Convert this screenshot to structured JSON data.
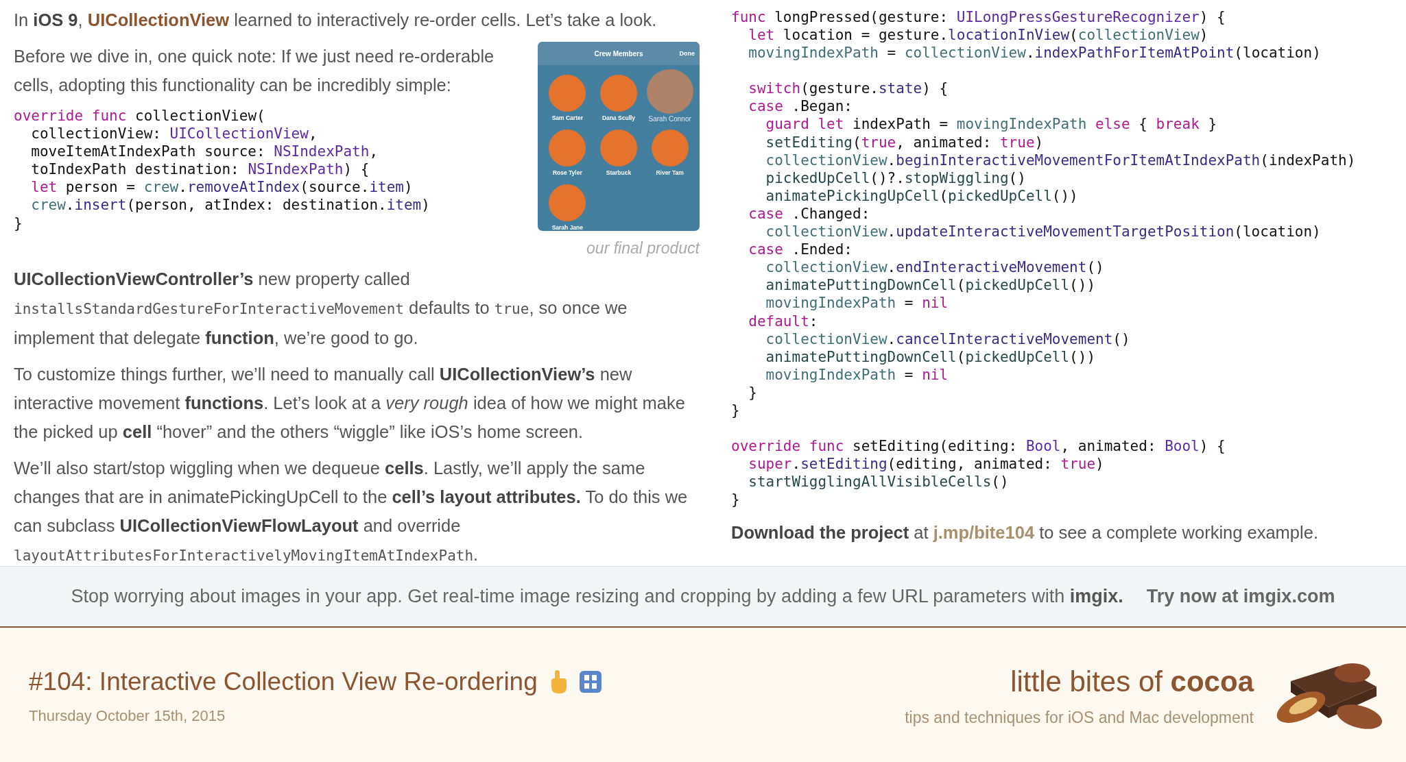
{
  "article": {
    "intro": [
      {
        "kind": "text",
        "text": "In **iOS 9**, "
      },
      {
        "kind": "link",
        "text": "UICollectionView"
      },
      {
        "kind": "text",
        "text": " learned to interactively re-order cells. Let’s take a look."
      }
    ],
    "note": [
      {
        "kind": "text",
        "text": "Before we dive in, one quick note: If we just need re-orderable cells, adopting this functionality can be incredibly simple:"
      }
    ],
    "figure": {
      "title": "Crew Members",
      "done": "Done",
      "caption": "our final product",
      "crew": [
        {
          "name": "Sam Carter",
          "lifted": false
        },
        {
          "name": "Dana Scully",
          "lifted": false
        },
        {
          "name": "Sarah Connor",
          "lifted": true
        },
        {
          "name": "Rose Tyler",
          "lifted": false
        },
        {
          "name": "Starbuck",
          "lifted": false
        },
        {
          "name": "River Tam",
          "lifted": false
        },
        {
          "name": "Sarah Jane",
          "lifted": false
        }
      ]
    },
    "code_left": [
      [
        [
          {
            "kind": "kw",
            "text": "override func"
          },
          {
            "kind": "p",
            "text": " collectionView("
          }
        ],
        [
          {
            "kind": "p",
            "text": "  collectionView: "
          },
          {
            "kind": "type",
            "text": "UICollectionView"
          },
          {
            "kind": "p",
            "text": ","
          }
        ],
        [
          {
            "kind": "p",
            "text": "  moveItemAtIndexPath source: "
          },
          {
            "kind": "type",
            "text": "NSIndexPath"
          },
          {
            "kind": "p",
            "text": ","
          }
        ],
        [
          {
            "kind": "p",
            "text": "  toIndexPath destination: "
          },
          {
            "kind": "type",
            "text": "NSIndexPath"
          },
          {
            "kind": "p",
            "text": ") {"
          }
        ],
        [
          {
            "kind": "kw",
            "text": "  let"
          },
          {
            "kind": "p",
            "text": " person = "
          },
          {
            "kind": "prop",
            "text": "crew"
          },
          {
            "kind": "p",
            "text": "."
          },
          {
            "kind": "sys",
            "text": "removeAtIndex"
          },
          {
            "kind": "p",
            "text": "(source."
          },
          {
            "kind": "sys",
            "text": "item"
          },
          {
            "kind": "p",
            "text": ")"
          }
        ],
        [
          {
            "kind": "prop",
            "text": "  crew"
          },
          {
            "kind": "p",
            "text": "."
          },
          {
            "kind": "sys",
            "text": "insert"
          },
          {
            "kind": "p",
            "text": "(person, atIndex: destination."
          },
          {
            "kind": "sys",
            "text": "item"
          },
          {
            "kind": "p",
            "text": ")"
          }
        ],
        [
          {
            "kind": "p",
            "text": "}"
          }
        ]
      ]
    ],
    "paragraphs": [
      [
        {
          "kind": "text",
          "text": "**UICollectionViewController’s** new property called "
        },
        {
          "kind": "code",
          "text": "installsStandardGestureForInteractiveMovement"
        },
        {
          "kind": "text",
          "text": " defaults to "
        },
        {
          "kind": "code",
          "text": "true"
        },
        {
          "kind": "text",
          "text": ", so once we implement that delegate **function**, we’re good to go."
        }
      ],
      [
        {
          "kind": "text",
          "text": "To customize things further, we’ll need to manually call **UICollectionView’s** new interactive movement **functions**. Let’s look at a *very rough* idea of how we might make the picked up **cell** “hover” and the others “wiggle” like iOS’s home screen."
        }
      ],
      [
        {
          "kind": "text",
          "text": "We’ll also start/stop wiggling when we dequeue **cells**. Lastly, we’ll apply the same changes that are in animatePickingUpCell to the **cell’s layout attributes.** To do this we can subclass **UICollectionViewFlowLayout** and override "
        },
        {
          "kind": "code",
          "text": "layoutAttributesForInteractivelyMovingItemAtIndexPath"
        },
        {
          "kind": "text",
          "text": "."
        }
      ]
    ],
    "code_right": [
      [
        [
          {
            "kind": "kw",
            "text": "func"
          },
          {
            "kind": "p",
            "text": " longPressed(gesture: "
          },
          {
            "kind": "type",
            "text": "UILongPressGestureRecognizer"
          },
          {
            "kind": "p",
            "text": ") {"
          }
        ],
        [
          {
            "kind": "kw",
            "text": "  let"
          },
          {
            "kind": "p",
            "text": " location = gesture."
          },
          {
            "kind": "sys",
            "text": "locationInView"
          },
          {
            "kind": "p",
            "text": "("
          },
          {
            "kind": "prop",
            "text": "collectionView"
          },
          {
            "kind": "p",
            "text": ")"
          }
        ],
        [
          {
            "kind": "prop",
            "text": "  movingIndexPath"
          },
          {
            "kind": "p",
            "text": " = "
          },
          {
            "kind": "prop",
            "text": "collectionView"
          },
          {
            "kind": "p",
            "text": "."
          },
          {
            "kind": "sys",
            "text": "indexPathForItemAtPoint"
          },
          {
            "kind": "p",
            "text": "(location)"
          }
        ]
      ],
      [
        [
          {
            "kind": "kw",
            "text": "  switch"
          },
          {
            "kind": "p",
            "text": "(gesture."
          },
          {
            "kind": "sys",
            "text": "state"
          },
          {
            "kind": "p",
            "text": ") {"
          }
        ],
        [
          {
            "kind": "kw",
            "text": "  case"
          },
          {
            "kind": "p",
            "text": " .Began:"
          }
        ],
        [
          {
            "kind": "kw",
            "text": "    guard let"
          },
          {
            "kind": "p",
            "text": " indexPath = "
          },
          {
            "kind": "prop",
            "text": "movingIndexPath"
          },
          {
            "kind": "kw",
            "text": " else"
          },
          {
            "kind": "p",
            "text": " { "
          },
          {
            "kind": "kw",
            "text": "break"
          },
          {
            "kind": "p",
            "text": " }"
          }
        ],
        [
          {
            "kind": "usr",
            "text": "    setEditing"
          },
          {
            "kind": "p",
            "text": "("
          },
          {
            "kind": "kw",
            "text": "true"
          },
          {
            "kind": "p",
            "text": ", animated: "
          },
          {
            "kind": "kw",
            "text": "true"
          },
          {
            "kind": "p",
            "text": ")"
          }
        ],
        [
          {
            "kind": "prop",
            "text": "    collectionView"
          },
          {
            "kind": "p",
            "text": "."
          },
          {
            "kind": "sys",
            "text": "beginInteractiveMovementForItemAtIndexPath"
          },
          {
            "kind": "p",
            "text": "(indexPath)"
          }
        ],
        [
          {
            "kind": "usr",
            "text": "    pickedUpCell"
          },
          {
            "kind": "p",
            "text": "()?."
          },
          {
            "kind": "usr",
            "text": "stopWiggling"
          },
          {
            "kind": "p",
            "text": "()"
          }
        ],
        [
          {
            "kind": "usr",
            "text": "    animatePickingUpCell"
          },
          {
            "kind": "p",
            "text": "("
          },
          {
            "kind": "usr",
            "text": "pickedUpCell"
          },
          {
            "kind": "p",
            "text": "())"
          }
        ],
        [
          {
            "kind": "kw",
            "text": "  case"
          },
          {
            "kind": "p",
            "text": " .Changed:"
          }
        ],
        [
          {
            "kind": "prop",
            "text": "    collectionView"
          },
          {
            "kind": "p",
            "text": "."
          },
          {
            "kind": "sys",
            "text": "updateInteractiveMovementTargetPosition"
          },
          {
            "kind": "p",
            "text": "(location)"
          }
        ],
        [
          {
            "kind": "kw",
            "text": "  case"
          },
          {
            "kind": "p",
            "text": " .Ended:"
          }
        ],
        [
          {
            "kind": "prop",
            "text": "    collectionView"
          },
          {
            "kind": "p",
            "text": "."
          },
          {
            "kind": "sys",
            "text": "endInteractiveMovement"
          },
          {
            "kind": "p",
            "text": "()"
          }
        ],
        [
          {
            "kind": "usr",
            "text": "    animatePuttingDownCell"
          },
          {
            "kind": "p",
            "text": "("
          },
          {
            "kind": "usr",
            "text": "pickedUpCell"
          },
          {
            "kind": "p",
            "text": "())"
          }
        ],
        [
          {
            "kind": "prop",
            "text": "    movingIndexPath"
          },
          {
            "kind": "p",
            "text": " = "
          },
          {
            "kind": "kw",
            "text": "nil"
          }
        ],
        [
          {
            "kind": "kw",
            "text": "  default"
          },
          {
            "kind": "p",
            "text": ":"
          }
        ],
        [
          {
            "kind": "prop",
            "text": "    collectionView"
          },
          {
            "kind": "p",
            "text": "."
          },
          {
            "kind": "sys",
            "text": "cancelInteractiveMovement"
          },
          {
            "kind": "p",
            "text": "()"
          }
        ],
        [
          {
            "kind": "usr",
            "text": "    animatePuttingDownCell"
          },
          {
            "kind": "p",
            "text": "("
          },
          {
            "kind": "usr",
            "text": "pickedUpCell"
          },
          {
            "kind": "p",
            "text": "())"
          }
        ],
        [
          {
            "kind": "prop",
            "text": "    movingIndexPath"
          },
          {
            "kind": "p",
            "text": " = "
          },
          {
            "kind": "kw",
            "text": "nil"
          }
        ],
        [
          {
            "kind": "p",
            "text": "  }"
          }
        ],
        [
          {
            "kind": "p",
            "text": "}"
          }
        ]
      ],
      [
        [
          {
            "kind": "kw",
            "text": "override func"
          },
          {
            "kind": "p",
            "text": " setEditing(editing: "
          },
          {
            "kind": "type",
            "text": "Bool"
          },
          {
            "kind": "p",
            "text": ", animated: "
          },
          {
            "kind": "type",
            "text": "Bool"
          },
          {
            "kind": "p",
            "text": ") {"
          }
        ],
        [
          {
            "kind": "kw",
            "text": "  super"
          },
          {
            "kind": "p",
            "text": "."
          },
          {
            "kind": "sys",
            "text": "setEditing"
          },
          {
            "kind": "p",
            "text": "(editing, animated: "
          },
          {
            "kind": "kw",
            "text": "true"
          },
          {
            "kind": "p",
            "text": ")"
          }
        ],
        [
          {
            "kind": "usr",
            "text": "  startWigglingAllVisibleCells"
          },
          {
            "kind": "p",
            "text": "()"
          }
        ],
        [
          {
            "kind": "p",
            "text": "}"
          }
        ]
      ]
    ],
    "download": [
      {
        "kind": "text",
        "text": "**Download the project** at "
      },
      {
        "kind": "link",
        "text": "j.mp/bite104"
      },
      {
        "kind": "text",
        "text": " to see a complete working example."
      }
    ]
  },
  "ad": {
    "text": "Stop worrying about images in your app. Get real-time image resizing and cropping by adding a few URL parameters with **imgix.**",
    "cta": "Try now at imgix.com"
  },
  "banner": {
    "title": "#104: Interactive Collection View Re-ordering",
    "date": "Thursday October 15th, 2015",
    "brand": "little bites of **cocoa**",
    "tagline": "tips and techniques for iOS and Mac development"
  }
}
